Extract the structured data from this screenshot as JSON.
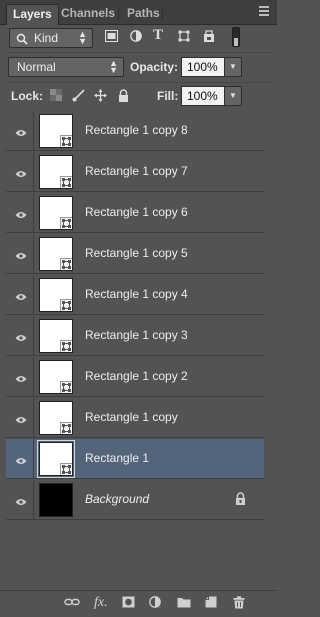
{
  "tabs": [
    {
      "label": "Layers",
      "active": true
    },
    {
      "label": "Channels",
      "active": false
    },
    {
      "label": "Paths",
      "active": false
    }
  ],
  "filter": {
    "kind_label": "Kind",
    "filter_icons": [
      "pixel-filter-icon",
      "adjustment-filter-icon",
      "type-filter-icon",
      "shape-filter-icon",
      "smart-object-filter-icon"
    ]
  },
  "blend": {
    "mode": "Normal"
  },
  "opacity": {
    "label": "Opacity:",
    "value": "100%"
  },
  "lock": {
    "label": "Lock:"
  },
  "fill": {
    "label": "Fill:",
    "value": "100%"
  },
  "layers": [
    {
      "name": "Rectangle 1 copy 8",
      "selected": false,
      "italic": false,
      "thumb": "white"
    },
    {
      "name": "Rectangle 1 copy 7",
      "selected": false,
      "italic": false,
      "thumb": "white"
    },
    {
      "name": "Rectangle 1 copy 6",
      "selected": false,
      "italic": false,
      "thumb": "white"
    },
    {
      "name": "Rectangle 1 copy 5",
      "selected": false,
      "italic": false,
      "thumb": "white"
    },
    {
      "name": "Rectangle 1 copy 4",
      "selected": false,
      "italic": false,
      "thumb": "white"
    },
    {
      "name": "Rectangle 1 copy 3",
      "selected": false,
      "italic": false,
      "thumb": "white"
    },
    {
      "name": "Rectangle 1 copy 2",
      "selected": false,
      "italic": false,
      "thumb": "white"
    },
    {
      "name": "Rectangle 1 copy",
      "selected": false,
      "italic": false,
      "thumb": "white"
    },
    {
      "name": "Rectangle 1",
      "selected": true,
      "italic": false,
      "thumb": "white"
    },
    {
      "name": "Background",
      "selected": false,
      "italic": true,
      "thumb": "black",
      "locked": true
    }
  ],
  "colors": {
    "panel_bg": "#535353",
    "tab_bar_bg": "#3f3f3f",
    "selected_row": "#54647a",
    "text": "#ededed"
  }
}
